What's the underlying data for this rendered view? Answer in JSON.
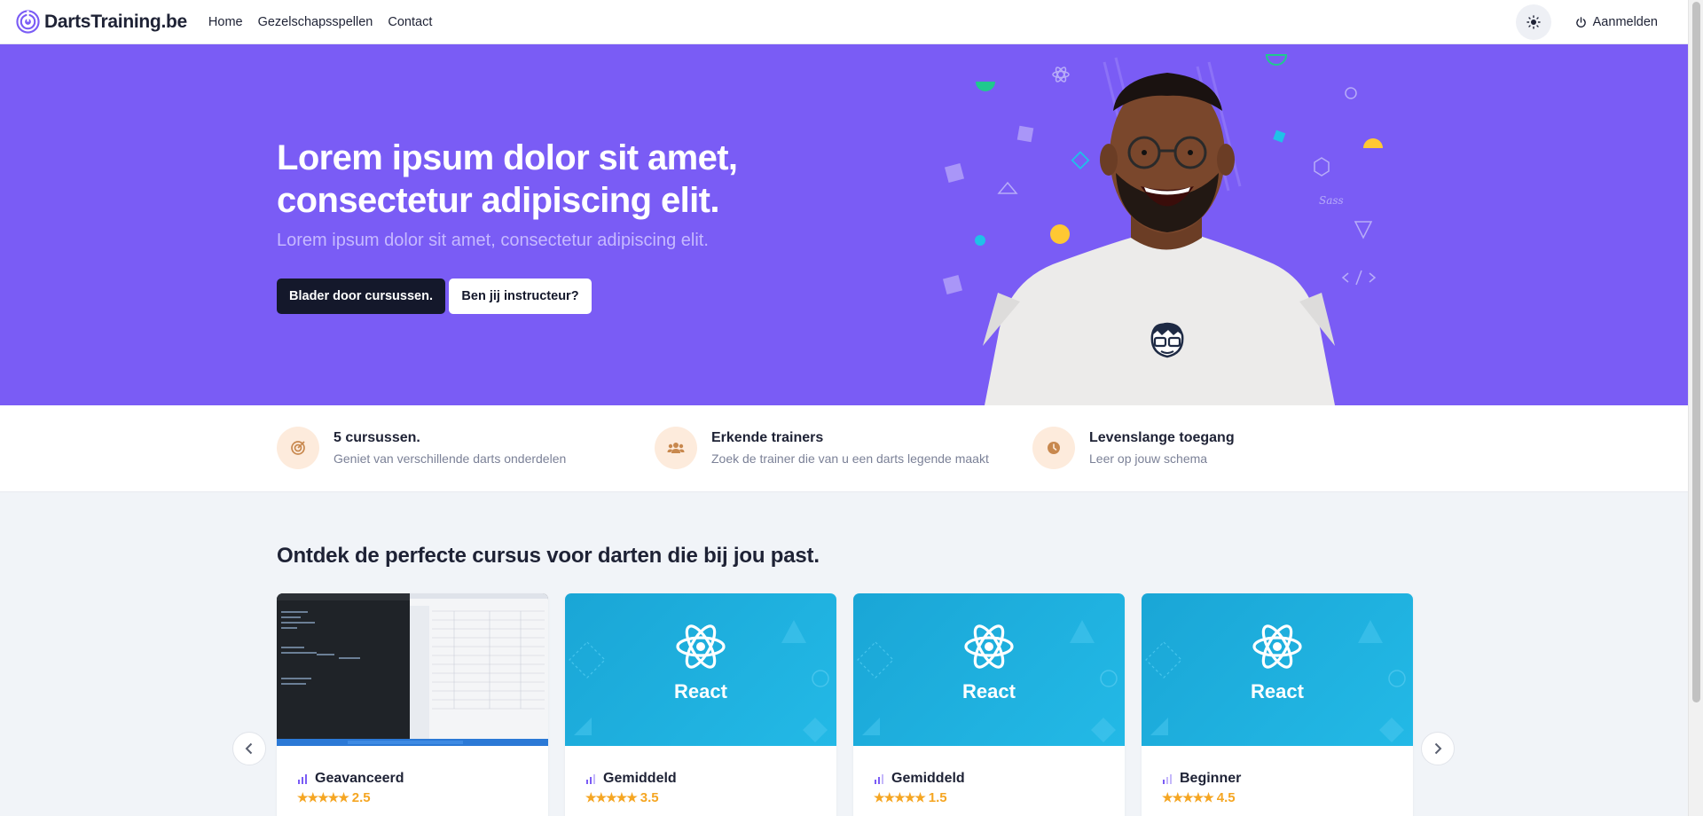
{
  "navbar": {
    "brand": "DartsTraining.be",
    "links": [
      "Home",
      "Gezelschapsspellen",
      "Contact"
    ],
    "login": "Aanmelden"
  },
  "hero": {
    "title": "Lorem ipsum dolor sit amet, consectetur adipiscing elit.",
    "subtitle": "Lorem ipsum dolor sit amet, consectetur adipiscing elit.",
    "primary_button": "Blader door cursussen.",
    "secondary_button": "Ben jij instructeur?",
    "background_color": "#7a5cf5"
  },
  "features": [
    {
      "title": "5 cursussen.",
      "description": "Geniet van verschillende darts onderdelen",
      "icon": "target-icon"
    },
    {
      "title": "Erkende trainers",
      "description": "Zoek de trainer die van u een darts legende maakt",
      "icon": "users-icon"
    },
    {
      "title": "Levenslange toegang",
      "description": "Leer op jouw schema",
      "icon": "clock-icon"
    }
  ],
  "courses": {
    "title": "Ontdek de perfecte cursus voor darten die bij jou past.",
    "items": [
      {
        "thumb_type": "code-screenshot",
        "thumb_label": "",
        "level": "Geavanceerd",
        "rating": "2.5",
        "rating_value": 2.5
      },
      {
        "thumb_type": "react",
        "thumb_label": "React",
        "level": "Gemiddeld",
        "rating": "3.5",
        "rating_value": 3.5
      },
      {
        "thumb_type": "react",
        "thumb_label": "React",
        "level": "Gemiddeld",
        "rating": "1.5",
        "rating_value": 1.5
      },
      {
        "thumb_type": "react",
        "thumb_label": "React",
        "level": "Beginner",
        "rating": "4.5",
        "rating_value": 4.5
      }
    ]
  },
  "colors": {
    "accent": "#7a5cf5",
    "star": "#f5a623",
    "react_thumb": "#1aa6d6"
  }
}
